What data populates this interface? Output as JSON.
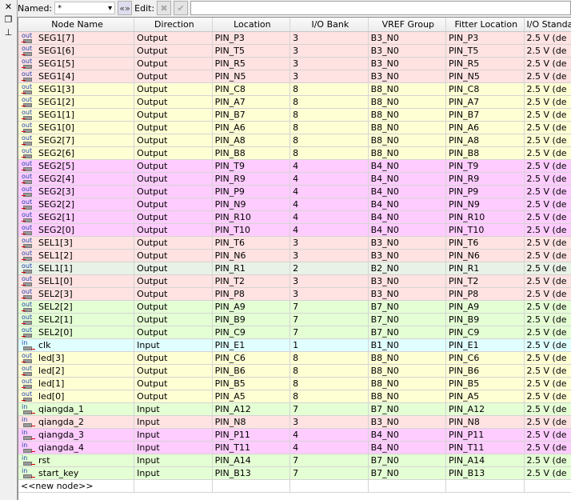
{
  "toolbar": {
    "named_label": "Named:",
    "named_value": "*",
    "edit_label": "Edit:"
  },
  "columns": [
    "Node Name",
    "Direction",
    "Location",
    "I/O Bank",
    "VREF Group",
    "Fitter Location",
    "I/O Standard"
  ],
  "bank_colors": {
    "1": "#e0ffff",
    "2": "#e8f2e6",
    "3": "#ffe2e2",
    "4": "#ffccff",
    "7": "#e4ffd4",
    "8": "#ffffd4"
  },
  "rows": [
    [
      "SEG1[7]",
      "Output",
      "PIN_P3",
      "3",
      "B3_N0",
      "PIN_P3",
      "2.5 V (de"
    ],
    [
      "SEG1[6]",
      "Output",
      "PIN_T5",
      "3",
      "B3_N0",
      "PIN_T5",
      "2.5 V (de"
    ],
    [
      "SEG1[5]",
      "Output",
      "PIN_R5",
      "3",
      "B3_N0",
      "PIN_R5",
      "2.5 V (de"
    ],
    [
      "SEG1[4]",
      "Output",
      "PIN_N5",
      "3",
      "B3_N0",
      "PIN_N5",
      "2.5 V (de"
    ],
    [
      "SEG1[3]",
      "Output",
      "PIN_C8",
      "8",
      "B8_N0",
      "PIN_C8",
      "2.5 V (de"
    ],
    [
      "SEG1[2]",
      "Output",
      "PIN_A7",
      "8",
      "B8_N0",
      "PIN_A7",
      "2.5 V (de"
    ],
    [
      "SEG1[1]",
      "Output",
      "PIN_B7",
      "8",
      "B8_N0",
      "PIN_B7",
      "2.5 V (de"
    ],
    [
      "SEG1[0]",
      "Output",
      "PIN_A6",
      "8",
      "B8_N0",
      "PIN_A6",
      "2.5 V (de"
    ],
    [
      "SEG2[7]",
      "Output",
      "PIN_A8",
      "8",
      "B8_N0",
      "PIN_A8",
      "2.5 V (de"
    ],
    [
      "SEG2[6]",
      "Output",
      "PIN_B8",
      "8",
      "B8_N0",
      "PIN_B8",
      "2.5 V (de"
    ],
    [
      "SEG2[5]",
      "Output",
      "PIN_T9",
      "4",
      "B4_N0",
      "PIN_T9",
      "2.5 V (de"
    ],
    [
      "SEG2[4]",
      "Output",
      "PIN_R9",
      "4",
      "B4_N0",
      "PIN_R9",
      "2.5 V (de"
    ],
    [
      "SEG2[3]",
      "Output",
      "PIN_P9",
      "4",
      "B4_N0",
      "PIN_P9",
      "2.5 V (de"
    ],
    [
      "SEG2[2]",
      "Output",
      "PIN_N9",
      "4",
      "B4_N0",
      "PIN_N9",
      "2.5 V (de"
    ],
    [
      "SEG2[1]",
      "Output",
      "PIN_R10",
      "4",
      "B4_N0",
      "PIN_R10",
      "2.5 V (de"
    ],
    [
      "SEG2[0]",
      "Output",
      "PIN_T10",
      "4",
      "B4_N0",
      "PIN_T10",
      "2.5 V (de"
    ],
    [
      "SEL1[3]",
      "Output",
      "PIN_T6",
      "3",
      "B3_N0",
      "PIN_T6",
      "2.5 V (de"
    ],
    [
      "SEL1[2]",
      "Output",
      "PIN_N6",
      "3",
      "B3_N0",
      "PIN_N6",
      "2.5 V (de"
    ],
    [
      "SEL1[1]",
      "Output",
      "PIN_R1",
      "2",
      "B2_N0",
      "PIN_R1",
      "2.5 V (de"
    ],
    [
      "SEL1[0]",
      "Output",
      "PIN_T2",
      "3",
      "B3_N0",
      "PIN_T2",
      "2.5 V (de"
    ],
    [
      "SEL2[3]",
      "Output",
      "PIN_P8",
      "3",
      "B3_N0",
      "PIN_P8",
      "2.5 V (de"
    ],
    [
      "SEL2[2]",
      "Output",
      "PIN_A9",
      "7",
      "B7_N0",
      "PIN_A9",
      "2.5 V (de"
    ],
    [
      "SEL2[1]",
      "Output",
      "PIN_B9",
      "7",
      "B7_N0",
      "PIN_B9",
      "2.5 V (de"
    ],
    [
      "SEL2[0]",
      "Output",
      "PIN_C9",
      "7",
      "B7_N0",
      "PIN_C9",
      "2.5 V (de"
    ],
    [
      "clk",
      "Input",
      "PIN_E1",
      "1",
      "B1_N0",
      "PIN_E1",
      "2.5 V (de"
    ],
    [
      "led[3]",
      "Output",
      "PIN_C6",
      "8",
      "B8_N0",
      "PIN_C6",
      "2.5 V (de"
    ],
    [
      "led[2]",
      "Output",
      "PIN_B6",
      "8",
      "B8_N0",
      "PIN_B6",
      "2.5 V (de"
    ],
    [
      "led[1]",
      "Output",
      "PIN_B5",
      "8",
      "B8_N0",
      "PIN_B5",
      "2.5 V (de"
    ],
    [
      "led[0]",
      "Output",
      "PIN_A5",
      "8",
      "B8_N0",
      "PIN_A5",
      "2.5 V (de"
    ],
    [
      "qiangda_1",
      "Input",
      "PIN_A12",
      "7",
      "B7_N0",
      "PIN_A12",
      "2.5 V (de"
    ],
    [
      "qiangda_2",
      "Input",
      "PIN_N8",
      "3",
      "B3_N0",
      "PIN_N8",
      "2.5 V (de"
    ],
    [
      "qiangda_3",
      "Input",
      "PIN_P11",
      "4",
      "B4_N0",
      "PIN_P11",
      "2.5 V (de"
    ],
    [
      "qiangda_4",
      "Input",
      "PIN_T11",
      "4",
      "B4_N0",
      "PIN_T11",
      "2.5 V (de"
    ],
    [
      "rst",
      "Input",
      "PIN_A14",
      "7",
      "B7_N0",
      "PIN_A14",
      "2.5 V (de"
    ],
    [
      "start_key",
      "Input",
      "PIN_B13",
      "7",
      "B7_N0",
      "PIN_B13",
      "2.5 V (de"
    ]
  ],
  "new_node": "<<new node>>",
  "pin_labels": {
    "Output": "out",
    "Input": "in"
  }
}
